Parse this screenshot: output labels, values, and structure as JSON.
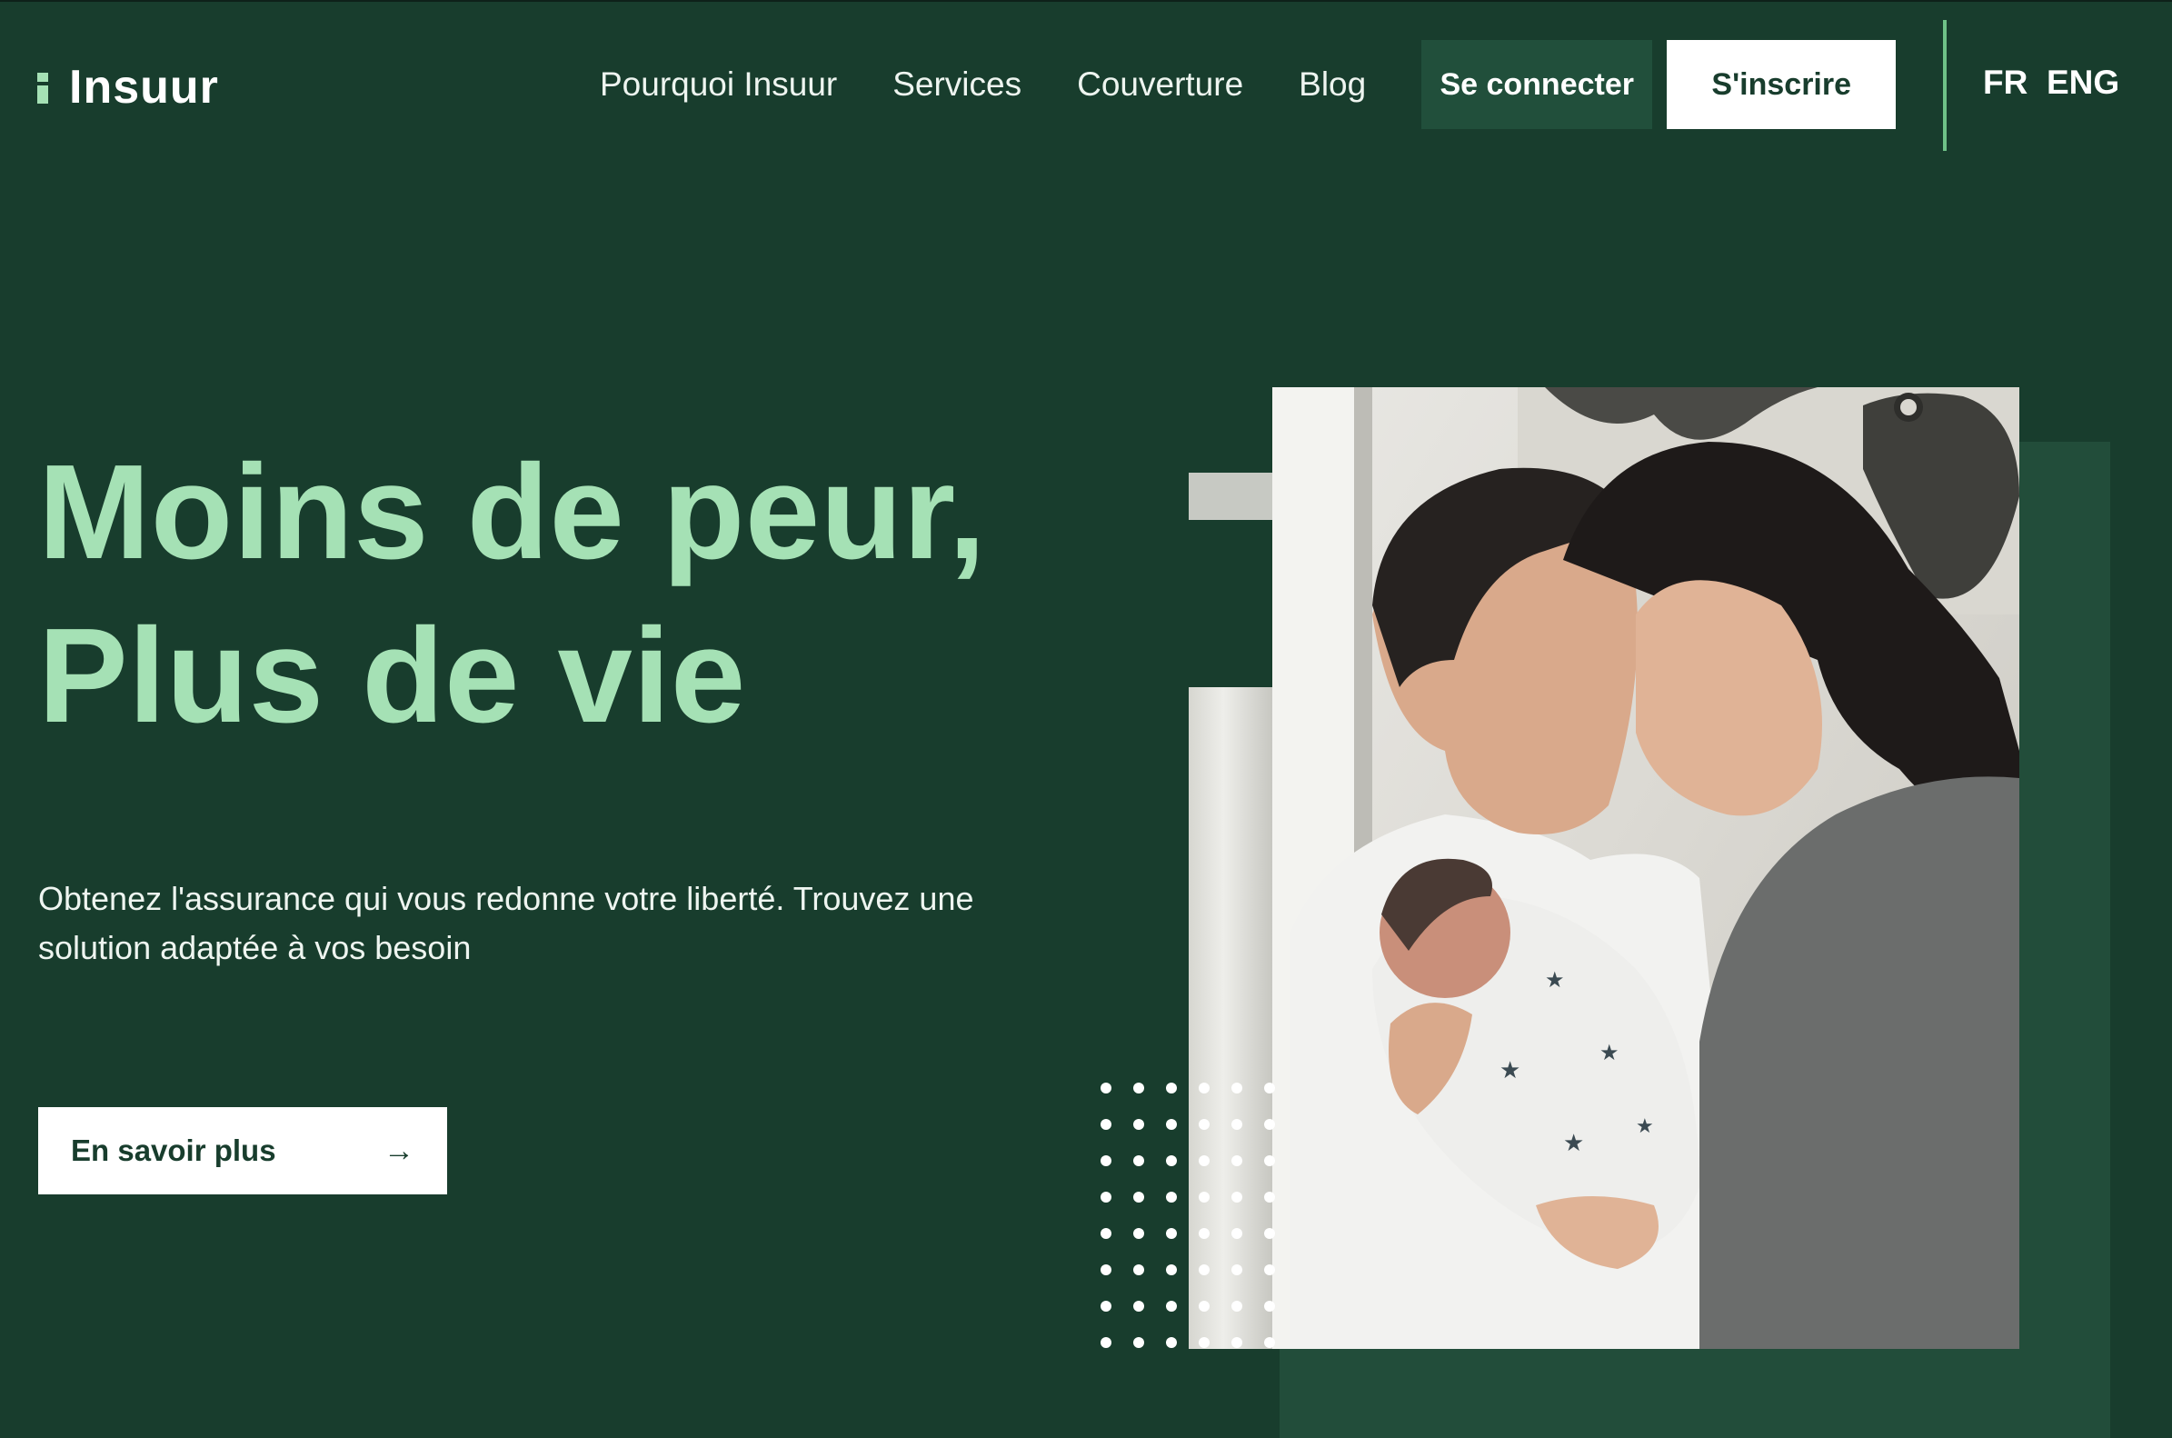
{
  "brand": {
    "name": "Insuur"
  },
  "nav": {
    "items": [
      "Pourquoi Insuur",
      "Services",
      "Couverture",
      "Blog"
    ],
    "login_label": "Se connecter",
    "signup_label": "S'inscrire",
    "languages": [
      "FR",
      "ENG"
    ]
  },
  "hero": {
    "title_line1": "Moins de peur,",
    "title_line2": "Plus de vie",
    "subtitle": "Obtenez l'assurance qui vous redonne votre liberté. Trouvez une solution adaptée à vos besoin",
    "cta_label": "En savoir plus",
    "cta_icon": "arrow-right-icon",
    "image": "family-with-newborn-photo"
  },
  "colors": {
    "background": "#183d2d",
    "accent": "#a5e1b5",
    "panel": "#224d3a",
    "divider": "#6fc288",
    "button": "#ffffff"
  }
}
